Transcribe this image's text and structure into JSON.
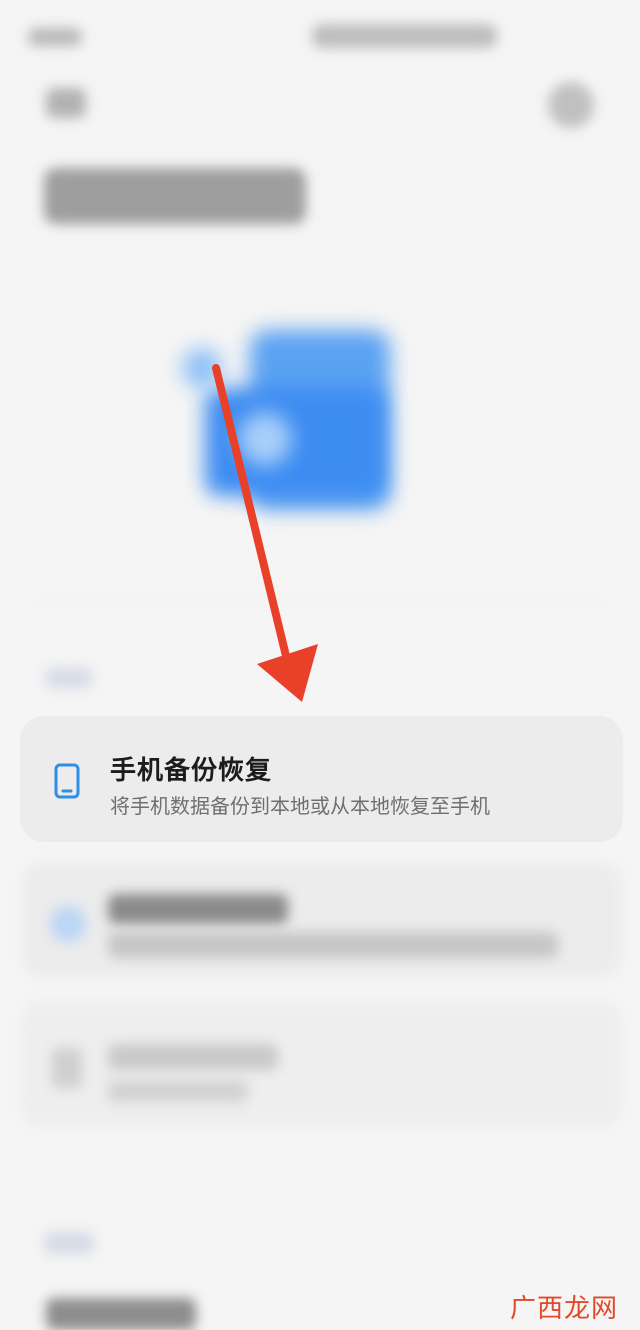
{
  "backup_card": {
    "title": "手机备份恢复",
    "description": "将手机数据备份到本地或从本地恢复至手机",
    "icon": "phone-icon"
  },
  "annotation": {
    "arrow_color": "#e9402a"
  },
  "colors": {
    "background": "#f5f5f5",
    "card": "#ececec",
    "accent_blue": "#3d8cf2",
    "watermark": "#e04a2a"
  },
  "watermark": {
    "text": "广西龙网"
  }
}
